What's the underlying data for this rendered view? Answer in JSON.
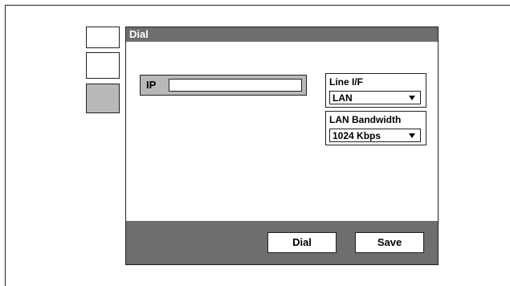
{
  "dialog": {
    "title": "Dial"
  },
  "ip": {
    "label": "IP",
    "value": ""
  },
  "line_if": {
    "title": "Line I/F",
    "selected": "LAN"
  },
  "lan_bandwidth": {
    "title": "LAN Bandwidth",
    "selected": "1024 Kbps"
  },
  "buttons": {
    "dial": "Dial",
    "save": "Save"
  }
}
